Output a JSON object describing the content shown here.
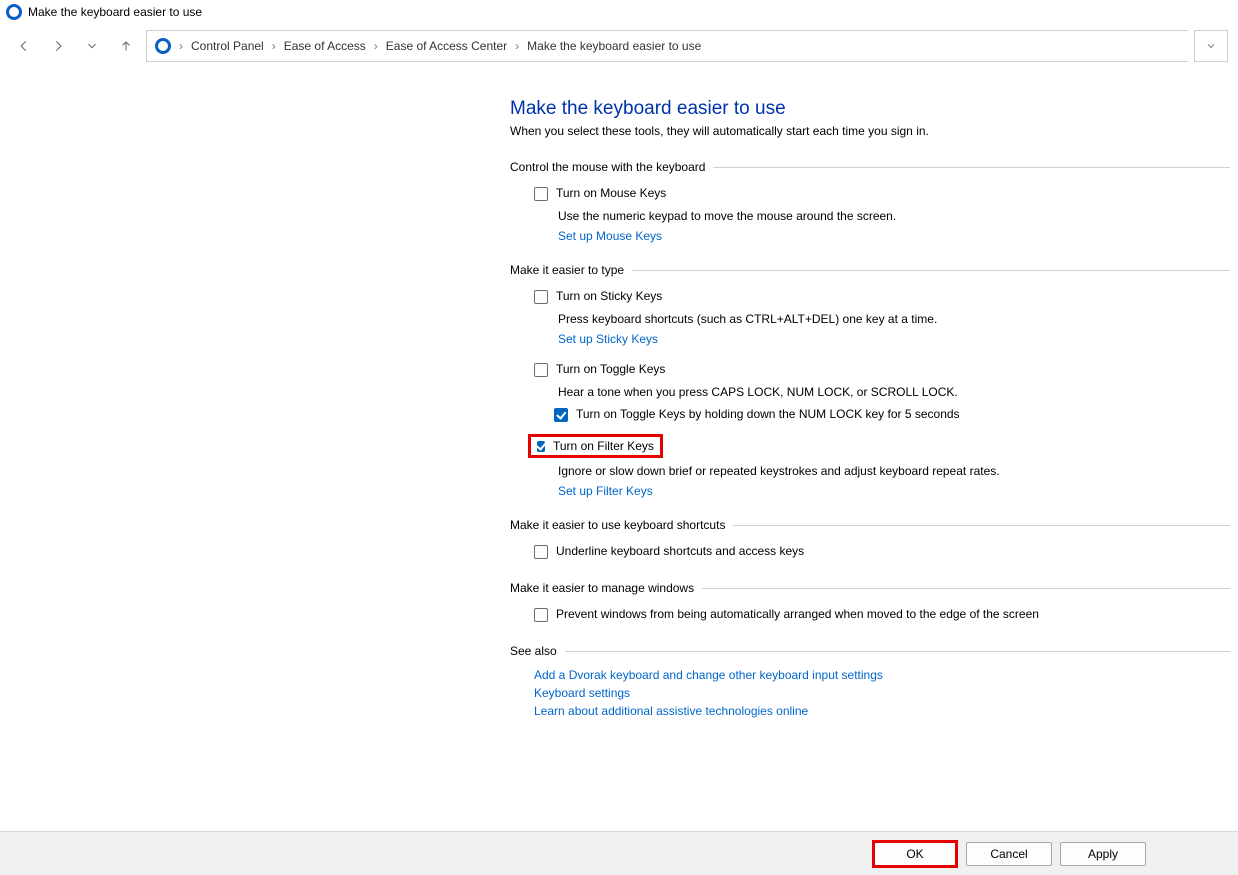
{
  "window": {
    "title": "Make the keyboard easier to use"
  },
  "breadcrumb": {
    "items": [
      "Control Panel",
      "Ease of Access",
      "Ease of Access Center",
      "Make the keyboard easier to use"
    ]
  },
  "page": {
    "heading": "Make the keyboard easier to use",
    "sub": "When you select these tools, they will automatically start each time you sign in."
  },
  "group_mouse": {
    "title": "Control the mouse with the keyboard",
    "mousekeys_label": "Turn on Mouse Keys",
    "mousekeys_checked": false,
    "mousekeys_desc": "Use the numeric keypad to move the mouse around the screen.",
    "mousekeys_link": "Set up Mouse Keys"
  },
  "group_type": {
    "title": "Make it easier to type",
    "sticky_label": "Turn on Sticky Keys",
    "sticky_checked": false,
    "sticky_desc": "Press keyboard shortcuts (such as CTRL+ALT+DEL) one key at a time.",
    "sticky_link": "Set up Sticky Keys",
    "toggle_label": "Turn on Toggle Keys",
    "toggle_checked": false,
    "toggle_desc": "Hear a tone when you press CAPS LOCK, NUM LOCK, or SCROLL LOCK.",
    "toggle_hold_label": "Turn on Toggle Keys by holding down the NUM LOCK key for 5 seconds",
    "toggle_hold_checked": true,
    "filter_label": "Turn on Filter Keys",
    "filter_checked": true,
    "filter_desc": "Ignore or slow down brief or repeated keystrokes and adjust keyboard repeat rates.",
    "filter_link": "Set up Filter Keys"
  },
  "group_shortcuts": {
    "title": "Make it easier to use keyboard shortcuts",
    "underline_label": "Underline keyboard shortcuts and access keys",
    "underline_checked": false
  },
  "group_windows": {
    "title": "Make it easier to manage windows",
    "prevent_label": "Prevent windows from being automatically arranged when moved to the edge of the screen",
    "prevent_checked": false
  },
  "see_also": {
    "title": "See also",
    "links": [
      "Add a Dvorak keyboard and change other keyboard input settings",
      "Keyboard settings",
      "Learn about additional assistive technologies online"
    ]
  },
  "footer": {
    "ok": "OK",
    "cancel": "Cancel",
    "apply": "Apply"
  }
}
